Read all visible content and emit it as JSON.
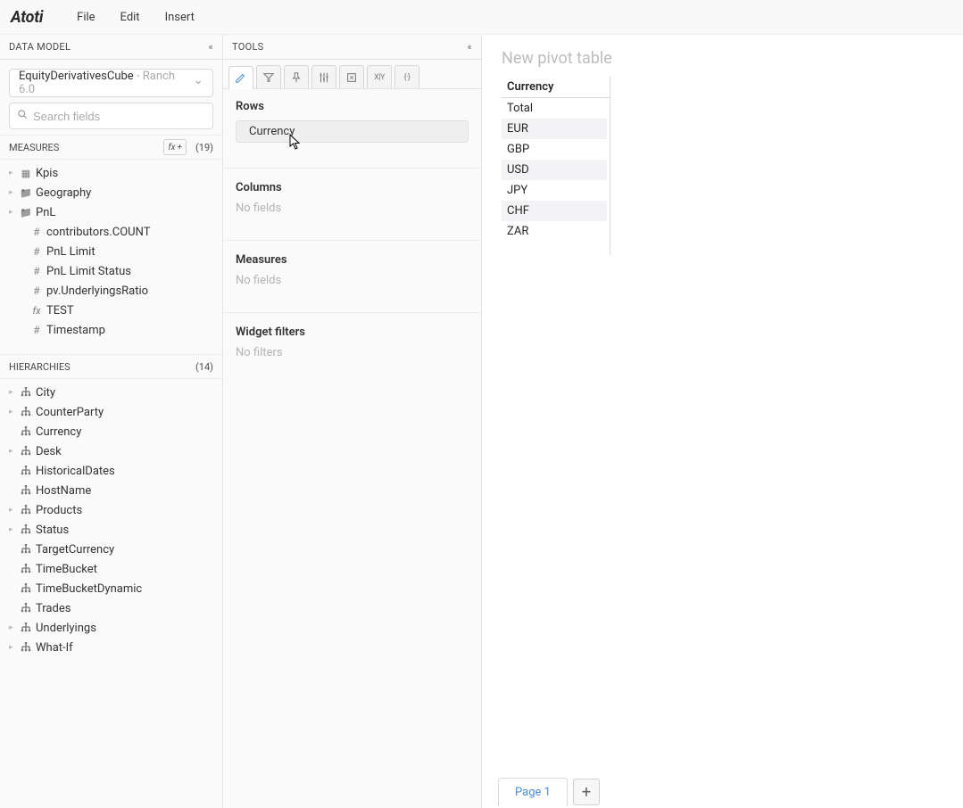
{
  "logo": "Atoti",
  "menubar": [
    "File",
    "Edit",
    "Insert"
  ],
  "dataModel": {
    "title": "DATA MODEL",
    "cube_name": "EquityDerivativesCube",
    "cube_env": "Ranch 6.0",
    "cube_sep": " - ",
    "search_placeholder": "Search fields",
    "measures_title": "MEASURES",
    "measures_count": "(19)",
    "fx_button": "fx",
    "plus_button": "+",
    "items": [
      {
        "label": "Kpis",
        "icon": "calc",
        "expandable": true,
        "indent": 0
      },
      {
        "label": "Geography",
        "icon": "folder",
        "expandable": true,
        "indent": 0
      },
      {
        "label": "PnL",
        "icon": "folder",
        "expandable": true,
        "indent": 0
      },
      {
        "label": "contributors.COUNT",
        "icon": "hash",
        "expandable": false,
        "indent": 1
      },
      {
        "label": "PnL Limit",
        "icon": "hash",
        "expandable": false,
        "indent": 1
      },
      {
        "label": "PnL Limit Status",
        "icon": "hash",
        "expandable": false,
        "indent": 1
      },
      {
        "label": "pv.UnderlyingsRatio",
        "icon": "hash",
        "expandable": false,
        "indent": 1
      },
      {
        "label": "TEST",
        "icon": "fx",
        "expandable": false,
        "indent": 1
      },
      {
        "label": "Timestamp",
        "icon": "hash",
        "expandable": false,
        "indent": 1
      }
    ],
    "hier_title": "HIERARCHIES",
    "hier_count": "(14)",
    "hier": [
      {
        "label": "City",
        "expandable": true
      },
      {
        "label": "CounterParty",
        "expandable": true
      },
      {
        "label": "Currency",
        "expandable": false
      },
      {
        "label": "Desk",
        "expandable": true
      },
      {
        "label": "HistoricalDates",
        "expandable": false
      },
      {
        "label": "HostName",
        "expandable": false
      },
      {
        "label": "Products",
        "expandable": true
      },
      {
        "label": "Status",
        "expandable": true
      },
      {
        "label": "TargetCurrency",
        "expandable": false
      },
      {
        "label": "TimeBucket",
        "expandable": false
      },
      {
        "label": "TimeBucketDynamic",
        "expandable": false
      },
      {
        "label": "Trades",
        "expandable": false
      },
      {
        "label": "Underlyings",
        "expandable": true
      },
      {
        "label": "What-If",
        "expandable": true
      }
    ]
  },
  "tools": {
    "title": "TOOLS",
    "tabs": [
      "pencil",
      "filter",
      "pin",
      "sliders",
      "box",
      "xy",
      "braces"
    ],
    "tab_labels": {
      "xy": "X|Y",
      "braces": "{·}"
    },
    "rows_title": "Rows",
    "rows_chip": "Currency",
    "columns_title": "Columns",
    "columns_placeholder": "No fields",
    "measures_title": "Measures",
    "measures_placeholder": "No fields",
    "filters_title": "Widget filters",
    "filters_placeholder": "No filters"
  },
  "canvas": {
    "title": "New pivot table",
    "header": "Currency",
    "rows": [
      "Total",
      "EUR",
      "GBP",
      "USD",
      "JPY",
      "CHF",
      "ZAR"
    ]
  },
  "tabbar": {
    "page": "Page 1",
    "add": "+"
  }
}
